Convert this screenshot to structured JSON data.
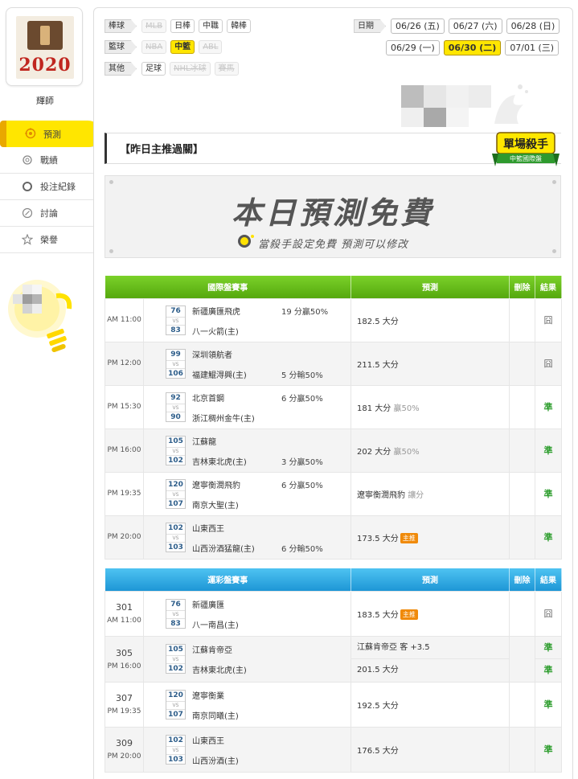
{
  "user": {
    "name": "輝師",
    "avatar_year": "2020"
  },
  "menu": [
    {
      "label": "預測",
      "icon": "target-icon",
      "active": true
    },
    {
      "label": "戰績",
      "icon": "medal-icon",
      "active": false
    },
    {
      "label": "投注紀錄",
      "icon": "ring-icon",
      "active": false
    },
    {
      "label": "討論",
      "icon": "chat-icon",
      "active": false
    },
    {
      "label": "榮譽",
      "icon": "trophy-icon",
      "active": false
    }
  ],
  "filters": {
    "baseball": {
      "label": "棒球",
      "options": [
        {
          "label": "MLB",
          "state": "disabled"
        },
        {
          "label": "日棒",
          "state": "normal"
        },
        {
          "label": "中職",
          "state": "normal"
        },
        {
          "label": "韓棒",
          "state": "normal"
        }
      ]
    },
    "basketball": {
      "label": "籃球",
      "options": [
        {
          "label": "NBA",
          "state": "disabled"
        },
        {
          "label": "中籃",
          "state": "selected"
        },
        {
          "label": "ABL",
          "state": "disabled"
        }
      ]
    },
    "other": {
      "label": "其他",
      "options": [
        {
          "label": "足球",
          "state": "normal"
        },
        {
          "label": "NHL冰球",
          "state": "disabled"
        },
        {
          "label": "賽馬",
          "state": "disabled"
        }
      ]
    },
    "date": {
      "label": "日期",
      "row1": [
        {
          "label": "06/26 (五)",
          "selected": false
        },
        {
          "label": "06/27 (六)",
          "selected": false
        },
        {
          "label": "06/28 (日)",
          "selected": false
        }
      ],
      "row2": [
        {
          "label": "06/29 (一)",
          "selected": false
        },
        {
          "label": "06/30 (二)",
          "selected": true
        },
        {
          "label": "07/01 (三)",
          "selected": false
        }
      ]
    }
  },
  "section_title": "【昨日主推過關】",
  "badge": {
    "title": "單場殺手",
    "subtitle": "中籃國際盤"
  },
  "banner": {
    "title": "本日預測免費",
    "subtitle": "當殺手設定免費 預測可以修改"
  },
  "intl_table": {
    "headers": [
      "國際盤賽事",
      "預測",
      "刪除",
      "結果"
    ],
    "rows": [
      {
        "time": "AM 11:00",
        "s1": "76",
        "s2": "83",
        "team1": "新疆廣匯飛虎",
        "team2": "八一火箭(主)",
        "line": "19 分贏50%",
        "line_on": "top",
        "pred": "182.5 大分",
        "extra": "",
        "tag": "",
        "result": "囧",
        "win": false
      },
      {
        "time": "PM 12:00",
        "s1": "99",
        "s2": "106",
        "team1": "深圳領航者",
        "team2": "福建鯤淂興(主)",
        "line": "5 分輸50%",
        "line_on": "bottom",
        "pred": "211.5 大分",
        "extra": "",
        "tag": "",
        "result": "囧",
        "win": false
      },
      {
        "time": "PM 15:30",
        "s1": "92",
        "s2": "90",
        "team1": "北京首鋼",
        "team2": "浙江稠州金牛(主)",
        "line": "6 分贏50%",
        "line_on": "top",
        "pred": "181 大分",
        "extra": "贏50%",
        "tag": "",
        "result": "準",
        "win": true
      },
      {
        "time": "PM 16:00",
        "s1": "105",
        "s2": "102",
        "team1": "江蘇龍",
        "team2": "吉林東北虎(主)",
        "line": "3 分贏50%",
        "line_on": "bottom",
        "pred": "202 大分",
        "extra": "贏50%",
        "tag": "",
        "result": "準",
        "win": true
      },
      {
        "time": "PM 19:35",
        "s1": "120",
        "s2": "107",
        "team1": "遼寧衡潤飛豹",
        "team2": "南京大聖(主)",
        "line": "6 分贏50%",
        "line_on": "top",
        "pred": "遼寧衡潤飛豹",
        "extra": "讓分",
        "tag": "",
        "result": "準",
        "win": true
      },
      {
        "time": "PM 20:00",
        "s1": "102",
        "s2": "103",
        "team1": "山東西王",
        "team2": "山西汾酒猛龍(主)",
        "line": "6 分輸50%",
        "line_on": "bottom",
        "pred": "173.5 大分",
        "extra": "",
        "tag": "主推",
        "result": "準",
        "win": true
      }
    ]
  },
  "lottery_table": {
    "headers": [
      "運彩盤賽事",
      "預測",
      "刪除",
      "結果"
    ],
    "rows": [
      {
        "num": "301",
        "time": "AM 11:00",
        "s1": "76",
        "s2": "83",
        "team1": "新疆廣匯",
        "team2": "八一南昌(主)",
        "preds": [
          {
            "pred": "183.5 大分",
            "extra": "",
            "tag": "主推",
            "result": "囧",
            "win": false
          }
        ]
      },
      {
        "num": "305",
        "time": "PM 16:00",
        "s1": "105",
        "s2": "102",
        "team1": "江蘇肯帝亞",
        "team2": "吉林東北虎(主)",
        "preds": [
          {
            "pred": "江蘇肯帝亞",
            "extra": "客 +3.5",
            "tag": "",
            "result": "準",
            "win": true
          },
          {
            "pred": "201.5 大分",
            "extra": "",
            "tag": "",
            "result": "準",
            "win": true
          }
        ]
      },
      {
        "num": "307",
        "time": "PM 19:35",
        "s1": "120",
        "s2": "107",
        "team1": "遼寧衡業",
        "team2": "南京同曦(主)",
        "preds": [
          {
            "pred": "192.5 大分",
            "extra": "",
            "tag": "",
            "result": "準",
            "win": true
          }
        ]
      },
      {
        "num": "309",
        "time": "PM 20:00",
        "s1": "102",
        "s2": "103",
        "team1": "山東西王",
        "team2": "山西汾酒(主)",
        "preds": [
          {
            "pred": "176.5 大分",
            "extra": "",
            "tag": "",
            "result": "準",
            "win": true
          }
        ]
      }
    ]
  },
  "colors": {
    "accent_yellow": "#ffe600",
    "header_green": "#5fb315",
    "header_blue": "#29a3e0",
    "win_green": "#2f9e2f",
    "tag_orange": "#f08a0a"
  }
}
